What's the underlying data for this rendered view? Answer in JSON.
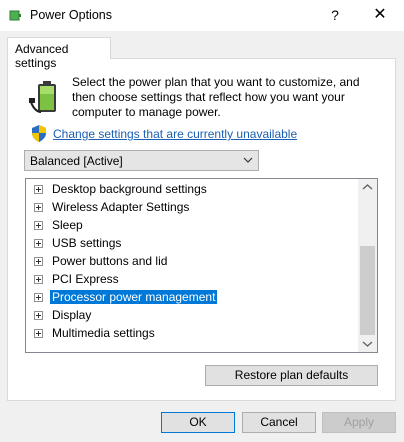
{
  "window": {
    "title": "Power Options",
    "help_label": "?",
    "close_label": "✕"
  },
  "tabs": [
    {
      "label": "Advanced settings",
      "active": true
    }
  ],
  "description": "Select the power plan that you want to customize, and then choose settings that reflect how you want your computer to manage power.",
  "change_link": "Change settings that are currently unavailable",
  "plan_select": {
    "value": "Balanced [Active]"
  },
  "tree_items": [
    {
      "label": "Desktop background settings",
      "selected": false
    },
    {
      "label": "Wireless Adapter Settings",
      "selected": false
    },
    {
      "label": "Sleep",
      "selected": false
    },
    {
      "label": "USB settings",
      "selected": false
    },
    {
      "label": "Power buttons and lid",
      "selected": false
    },
    {
      "label": "PCI Express",
      "selected": false
    },
    {
      "label": "Processor power management",
      "selected": true
    },
    {
      "label": "Display",
      "selected": false
    },
    {
      "label": "Multimedia settings",
      "selected": false
    }
  ],
  "buttons": {
    "restore": "Restore plan defaults",
    "ok": "OK",
    "cancel": "Cancel",
    "apply": "Apply"
  },
  "colors": {
    "selection": "#0078d7",
    "link": "#1a5fb4"
  },
  "icons": {
    "app": "power-options-icon",
    "battery": "battery-plug-icon",
    "shield": "uac-shield-icon"
  }
}
